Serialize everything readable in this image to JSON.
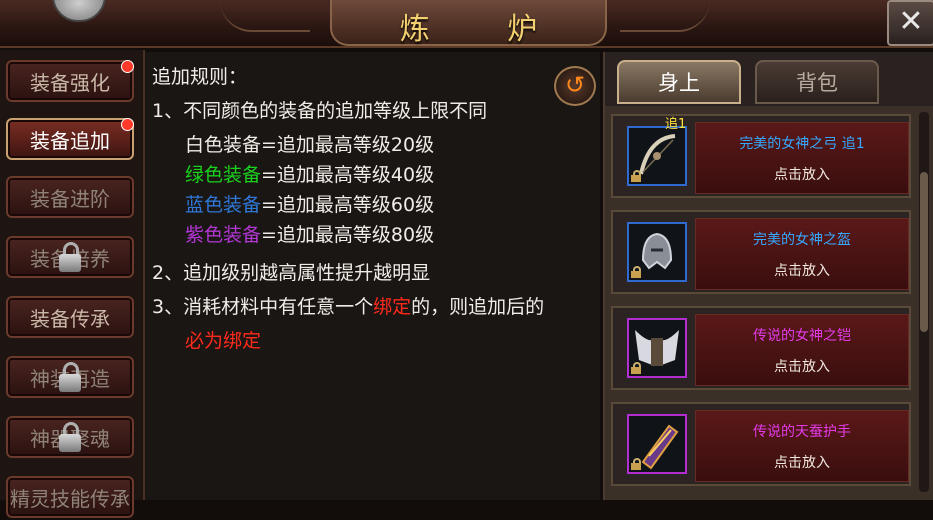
{
  "header": {
    "title": "炼 炉",
    "close_icon": "close-icon"
  },
  "nav": {
    "items": [
      {
        "label": "装备强化",
        "state": "normal",
        "badge": true,
        "locked": false
      },
      {
        "label": "装备追加",
        "state": "active",
        "badge": true,
        "locked": false
      },
      {
        "label": "装备进阶",
        "state": "dim",
        "badge": false,
        "locked": false
      },
      {
        "label": "装备培养",
        "state": "dim",
        "badge": false,
        "locked": true
      },
      {
        "label": "装备传承",
        "state": "normal",
        "badge": false,
        "locked": false
      },
      {
        "label": "神装再造",
        "state": "dim",
        "badge": false,
        "locked": true
      },
      {
        "label": "神器聚魂",
        "state": "dim",
        "badge": false,
        "locked": true
      },
      {
        "label": "精灵技能传承",
        "state": "dim",
        "badge": false,
        "locked": false
      }
    ]
  },
  "rules": {
    "title": "追加规则：",
    "line1": "1、不同颜色的装备的追加等级上限不同",
    "white_label": "白色装备",
    "white_rest": "=追加最高等级20级",
    "green_label": "绿色装备",
    "green_rest": "=追加最高等级40级",
    "blue_label": "蓝色装备",
    "blue_rest": "=追加最高等级60级",
    "purple_label": "紫色装备",
    "purple_rest": "=追加最高等级80级",
    "line2": "2、追加级别越高属性提升越明显",
    "line3_a": "3、消耗材料中有任意一个",
    "line3_red": "绑定",
    "line3_b": "的，则追加后的",
    "line4_red": "必为绑定"
  },
  "tabs": {
    "on_body": "身上",
    "bag": "背包"
  },
  "items": [
    {
      "name": "完美的女神之弓 追1",
      "action": "点击放入",
      "color": "blue",
      "tag": "追1",
      "icon": "bow-icon"
    },
    {
      "name": "完美的女神之盔",
      "action": "点击放入",
      "color": "blue",
      "tag": "",
      "icon": "helmet-icon"
    },
    {
      "name": "传说的女神之铠",
      "action": "点击放入",
      "color": "purple",
      "tag": "",
      "icon": "armor-icon"
    },
    {
      "name": "传说的天蚕护手",
      "action": "点击放入",
      "color": "purple",
      "tag": "",
      "icon": "gauntlet-icon"
    }
  ]
}
